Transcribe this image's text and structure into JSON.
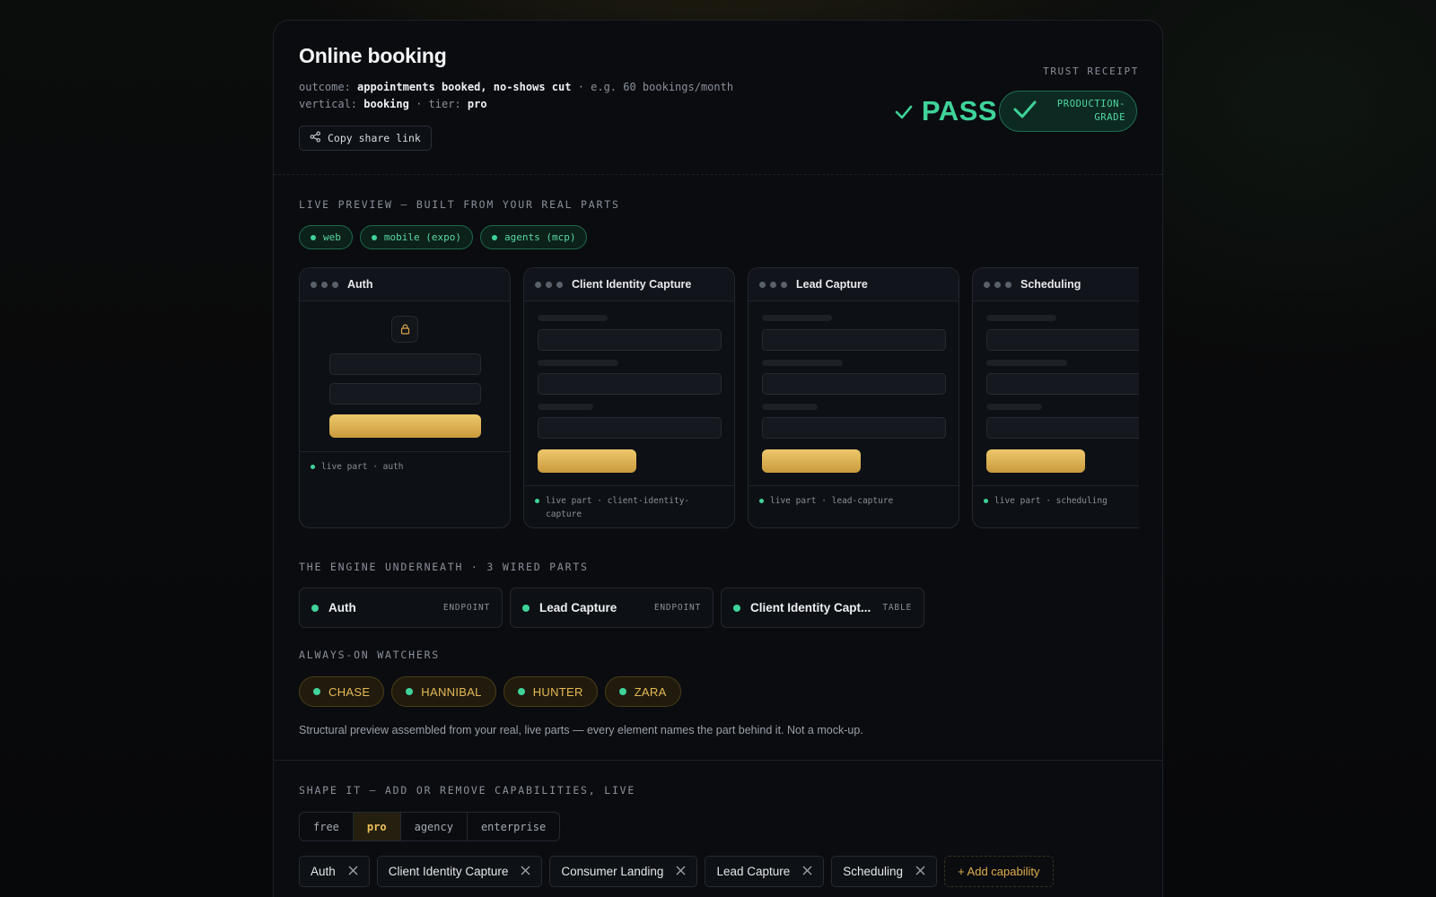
{
  "header": {
    "title": "Online booking",
    "outcome_label": "outcome:",
    "outcome_value": "appointments booked, no-shows cut",
    "outcome_example": "· e.g. 60 bookings/month",
    "vertical_label": "vertical:",
    "vertical_value": "booking",
    "tier_label": "· tier:",
    "tier_value": "pro",
    "share_label": "Copy share link",
    "receipt_label": "TRUST RECEIPT",
    "verdict": "PASS",
    "grade_line1": "PRODUCTION-",
    "grade_line2": "GRADE"
  },
  "preview": {
    "section_label": "LIVE PREVIEW — BUILT FROM YOUR REAL PARTS",
    "platforms": [
      "web",
      "mobile (expo)",
      "agents (mcp)"
    ],
    "cards": [
      {
        "title": "Auth",
        "footer": "live part · auth"
      },
      {
        "title": "Client Identity Capture",
        "footer": "live part · client-identity-capture"
      },
      {
        "title": "Lead Capture",
        "footer": "live part · lead-capture"
      },
      {
        "title": "Scheduling",
        "footer": "live part · scheduling"
      }
    ]
  },
  "engine": {
    "section_label": "THE ENGINE UNDERNEATH · 3 WIRED PARTS",
    "parts": [
      {
        "name": "Auth",
        "type": "ENDPOINT"
      },
      {
        "name": "Lead Capture",
        "type": "ENDPOINT"
      },
      {
        "name": "Client Identity Capt...",
        "type": "TABLE"
      }
    ]
  },
  "watchers": {
    "section_label": "ALWAYS-ON WATCHERS",
    "items": [
      "CHASE",
      "HANNIBAL",
      "HUNTER",
      "ZARA"
    ]
  },
  "note": "Structural preview assembled from your real, live parts — every element names the part behind it. Not a mock-up.",
  "shape": {
    "section_label": "SHAPE IT — ADD OR REMOVE CAPABILITIES, LIVE",
    "tiers": [
      "free",
      "pro",
      "agency",
      "enterprise"
    ],
    "active_tier": "pro",
    "capabilities": [
      "Auth",
      "Client Identity Capture",
      "Consumer Landing",
      "Lead Capture",
      "Scheduling"
    ],
    "add_label": "+ Add capability"
  },
  "colors": {
    "accent_green": "#3fd39a",
    "accent_gold": "#e6b956"
  }
}
